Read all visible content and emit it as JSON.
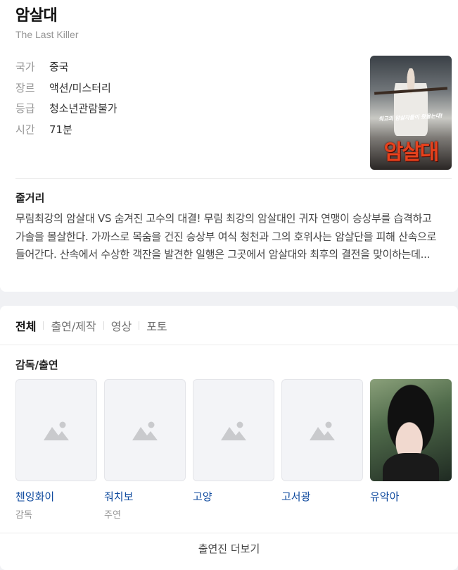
{
  "movie": {
    "title": "암살대",
    "subtitle": "The Last Killer",
    "meta": [
      {
        "key": "국가",
        "value": "중국"
      },
      {
        "key": "장르",
        "value": "액션/미스터리"
      },
      {
        "key": "등급",
        "value": "청소년관람불가"
      },
      {
        "key": "시간",
        "value": "71분"
      }
    ],
    "poster": {
      "tagline": "최고의 암살자들이 왔을는대!",
      "big_text": "암살대"
    },
    "synopsis_heading": "줄거리",
    "synopsis": "무림최강의 암살대 VS 숨겨진 고수의 대결! 무림 최강의 암살대인 귀자 연맹이 승상부를 습격하고 가솔을 몰살한다. 가까스로 목숨을 건진 승상부 여식 청천과 그의 호위사는 암살단을 피해 산속으로 들어간다. 산속에서 수상한 객잔을 발견한 일행은 그곳에서 암살대와 최후의 결전을 맞이하는데..."
  },
  "tabs": [
    "전체",
    "출연/제작",
    "영상",
    "포토"
  ],
  "cast": {
    "heading": "감독/출연",
    "people": [
      {
        "name": "첸잉화이",
        "role": "감독",
        "has_photo": false
      },
      {
        "name": "줘치보",
        "role": "주연",
        "has_photo": false
      },
      {
        "name": "고양",
        "role": "",
        "has_photo": false
      },
      {
        "name": "고서광",
        "role": "",
        "has_photo": false
      },
      {
        "name": "유악아",
        "role": "",
        "has_photo": true
      }
    ],
    "more_label": "출연진 더보기"
  },
  "colors": {
    "link": "#0f4a9e",
    "muted": "#959595",
    "poster_title": "#e8411c"
  }
}
